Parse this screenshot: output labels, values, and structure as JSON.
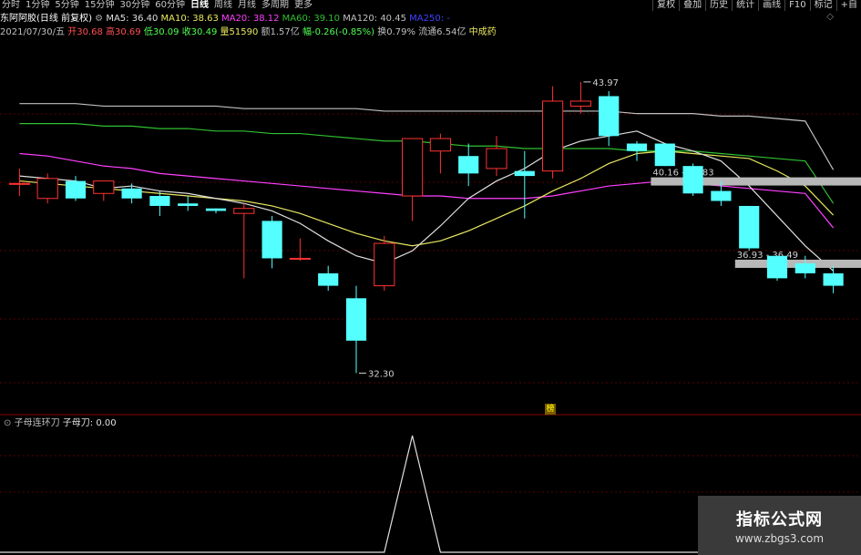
{
  "topbar": {
    "tabs": [
      "分时",
      "1分钟",
      "5分钟",
      "15分钟",
      "30分钟",
      "60分钟",
      "日线",
      "周线",
      "月线",
      "多周期",
      "更多"
    ],
    "active_tab": "日线",
    "tools": [
      "复权",
      "叠加",
      "历史",
      "统计",
      "画线",
      "F10",
      "标记",
      "+自"
    ]
  },
  "info": {
    "stock": "东阿阿胶(日线 前复权)",
    "ma5": "MA5: 36.40",
    "ma10": "MA10: 38.63",
    "ma20": "MA20: 38.12",
    "ma60": "MA60: 39.10",
    "ma120": "MA120: 40.45",
    "ma250": "MA250: -",
    "date": "2021/07/30/五",
    "open": "开30.68",
    "high": "高30.69",
    "low": "低30.09",
    "close": "收30.49",
    "volume": "量51590",
    "amount": "额1.57亿",
    "change": "幅-0.26(-0.85%)",
    "turnover": "换0.79%",
    "float": "流通6.54亿",
    "sector": "中成药"
  },
  "colors": {
    "up": "#ff3232",
    "down": "#54ffff",
    "ma5": "#e0e0e0",
    "ma10": "#e8e860",
    "ma20": "#ff40ff",
    "ma60": "#30c030",
    "ma120": "#c0c0c0",
    "ma250": "#4040ff"
  },
  "sub": {
    "title": "子母连环刀",
    "value_label": "子母刀: 0.00"
  },
  "badge": "榜",
  "watermark": {
    "title": "指标公式网",
    "url": "www.zbgs3.com"
  },
  "chart_data": {
    "type": "candlestick",
    "ylim": [
      31.0,
      45.5
    ],
    "candles": [
      {
        "o": 39.9,
        "h": 40.5,
        "l": 39.4,
        "c": 39.9
      },
      {
        "o": 39.3,
        "h": 40.3,
        "l": 39.1,
        "c": 40.1
      },
      {
        "o": 40.0,
        "h": 40.2,
        "l": 39.2,
        "c": 39.3
      },
      {
        "o": 39.5,
        "h": 40.0,
        "l": 39.2,
        "c": 40.0
      },
      {
        "o": 39.7,
        "h": 39.9,
        "l": 39.1,
        "c": 39.3
      },
      {
        "o": 39.4,
        "h": 39.6,
        "l": 38.6,
        "c": 39.0
      },
      {
        "o": 39.1,
        "h": 39.4,
        "l": 38.8,
        "c": 39.0
      },
      {
        "o": 38.9,
        "h": 38.9,
        "l": 38.7,
        "c": 38.8
      },
      {
        "o": 38.7,
        "h": 39.1,
        "l": 36.1,
        "c": 38.9
      },
      {
        "o": 38.4,
        "h": 38.6,
        "l": 36.5,
        "c": 36.9
      },
      {
        "o": 36.9,
        "h": 37.7,
        "l": 36.8,
        "c": 36.9
      },
      {
        "o": 36.3,
        "h": 36.6,
        "l": 35.6,
        "c": 35.8
      },
      {
        "o": 35.3,
        "h": 35.8,
        "l": 32.3,
        "c": 33.6
      },
      {
        "o": 35.8,
        "h": 37.8,
        "l": 35.6,
        "c": 37.5
      },
      {
        "o": 39.4,
        "h": 41.2,
        "l": 38.4,
        "c": 41.7
      },
      {
        "o": 41.2,
        "h": 41.9,
        "l": 40.3,
        "c": 41.7
      },
      {
        "o": 41.0,
        "h": 41.5,
        "l": 39.8,
        "c": 40.3
      },
      {
        "o": 40.5,
        "h": 41.8,
        "l": 40.2,
        "c": 41.3
      },
      {
        "o": 40.4,
        "h": 41.2,
        "l": 38.5,
        "c": 40.2
      },
      {
        "o": 40.4,
        "h": 43.8,
        "l": 40.1,
        "c": 43.2
      },
      {
        "o": 43.0,
        "h": 43.97,
        "l": 42.7,
        "c": 43.2
      },
      {
        "o": 43.4,
        "h": 43.6,
        "l": 41.4,
        "c": 41.8
      },
      {
        "o": 41.5,
        "h": 41.6,
        "l": 40.8,
        "c": 41.2
      },
      {
        "o": 41.5,
        "h": 41.5,
        "l": 40.9,
        "c": 40.6
      },
      {
        "o": 40.6,
        "h": 40.7,
        "l": 39.4,
        "c": 39.5
      },
      {
        "o": 39.6,
        "h": 40.0,
        "l": 39.0,
        "c": 39.2
      },
      {
        "o": 39.0,
        "h": 39.0,
        "l": 37.2,
        "c": 37.3
      },
      {
        "o": 37.0,
        "h": 37.0,
        "l": 36.0,
        "c": 36.1
      },
      {
        "o": 36.7,
        "h": 37.0,
        "l": 36.1,
        "c": 36.3
      },
      {
        "o": 36.3,
        "h": 36.6,
        "l": 35.5,
        "c": 35.8
      }
    ],
    "ma5": [
      40.2,
      40.1,
      40.0,
      39.7,
      39.8,
      39.6,
      39.5,
      39.3,
      39.1,
      38.8,
      38.3,
      37.6,
      37.0,
      36.7,
      37.2,
      38.2,
      39.3,
      40.0,
      40.5,
      41.2,
      41.6,
      41.8,
      42.0,
      41.5,
      41.2,
      40.8,
      39.8,
      38.6,
      37.4,
      36.4
    ],
    "ma10": [
      40.0,
      39.9,
      39.8,
      39.7,
      39.6,
      39.5,
      39.4,
      39.3,
      39.2,
      39.0,
      38.7,
      38.3,
      37.9,
      37.6,
      37.4,
      37.6,
      38.0,
      38.5,
      39.0,
      39.6,
      40.1,
      40.7,
      41.1,
      41.2,
      41.1,
      41.0,
      40.9,
      40.4,
      39.8,
      38.63
    ],
    "ma20": [
      41.1,
      41.0,
      40.8,
      40.6,
      40.5,
      40.3,
      40.2,
      40.1,
      40.0,
      39.9,
      39.8,
      39.7,
      39.6,
      39.5,
      39.4,
      39.4,
      39.3,
      39.3,
      39.3,
      39.4,
      39.6,
      39.8,
      39.9,
      40.0,
      39.9,
      39.8,
      39.7,
      39.6,
      39.5,
      38.12
    ],
    "ma60": [
      42.3,
      42.3,
      42.3,
      42.2,
      42.2,
      42.1,
      42.1,
      42.0,
      42.0,
      41.9,
      41.9,
      41.8,
      41.7,
      41.6,
      41.6,
      41.5,
      41.4,
      41.4,
      41.3,
      41.3,
      41.3,
      41.3,
      41.2,
      41.2,
      41.2,
      41.1,
      41.0,
      40.9,
      40.8,
      39.1
    ],
    "ma120": [
      43.1,
      43.1,
      43.1,
      43.0,
      43.0,
      43.0,
      43.0,
      43.0,
      42.9,
      42.9,
      42.9,
      42.9,
      42.9,
      42.8,
      42.8,
      42.8,
      42.8,
      42.8,
      42.8,
      42.8,
      42.8,
      42.8,
      42.7,
      42.7,
      42.7,
      42.6,
      42.6,
      42.5,
      42.4,
      40.45
    ],
    "annotations": [
      {
        "index": 20,
        "value": 43.97,
        "label": "43.97"
      },
      {
        "index": 12,
        "value": 32.3,
        "label": "32.30"
      }
    ],
    "resistance_boxes": [
      {
        "start": 23,
        "label": "40.16 - 39.83",
        "value": 40.0
      },
      {
        "start": 26,
        "label": "36.93 - 36.49",
        "value": 36.7
      }
    ],
    "sub_series": [
      0,
      0,
      0,
      0,
      0,
      0,
      0,
      0,
      0,
      0,
      0,
      0,
      0,
      0,
      1,
      0,
      0,
      0,
      0,
      0,
      0,
      0,
      0,
      0,
      0,
      0,
      0,
      0,
      0,
      0
    ]
  }
}
